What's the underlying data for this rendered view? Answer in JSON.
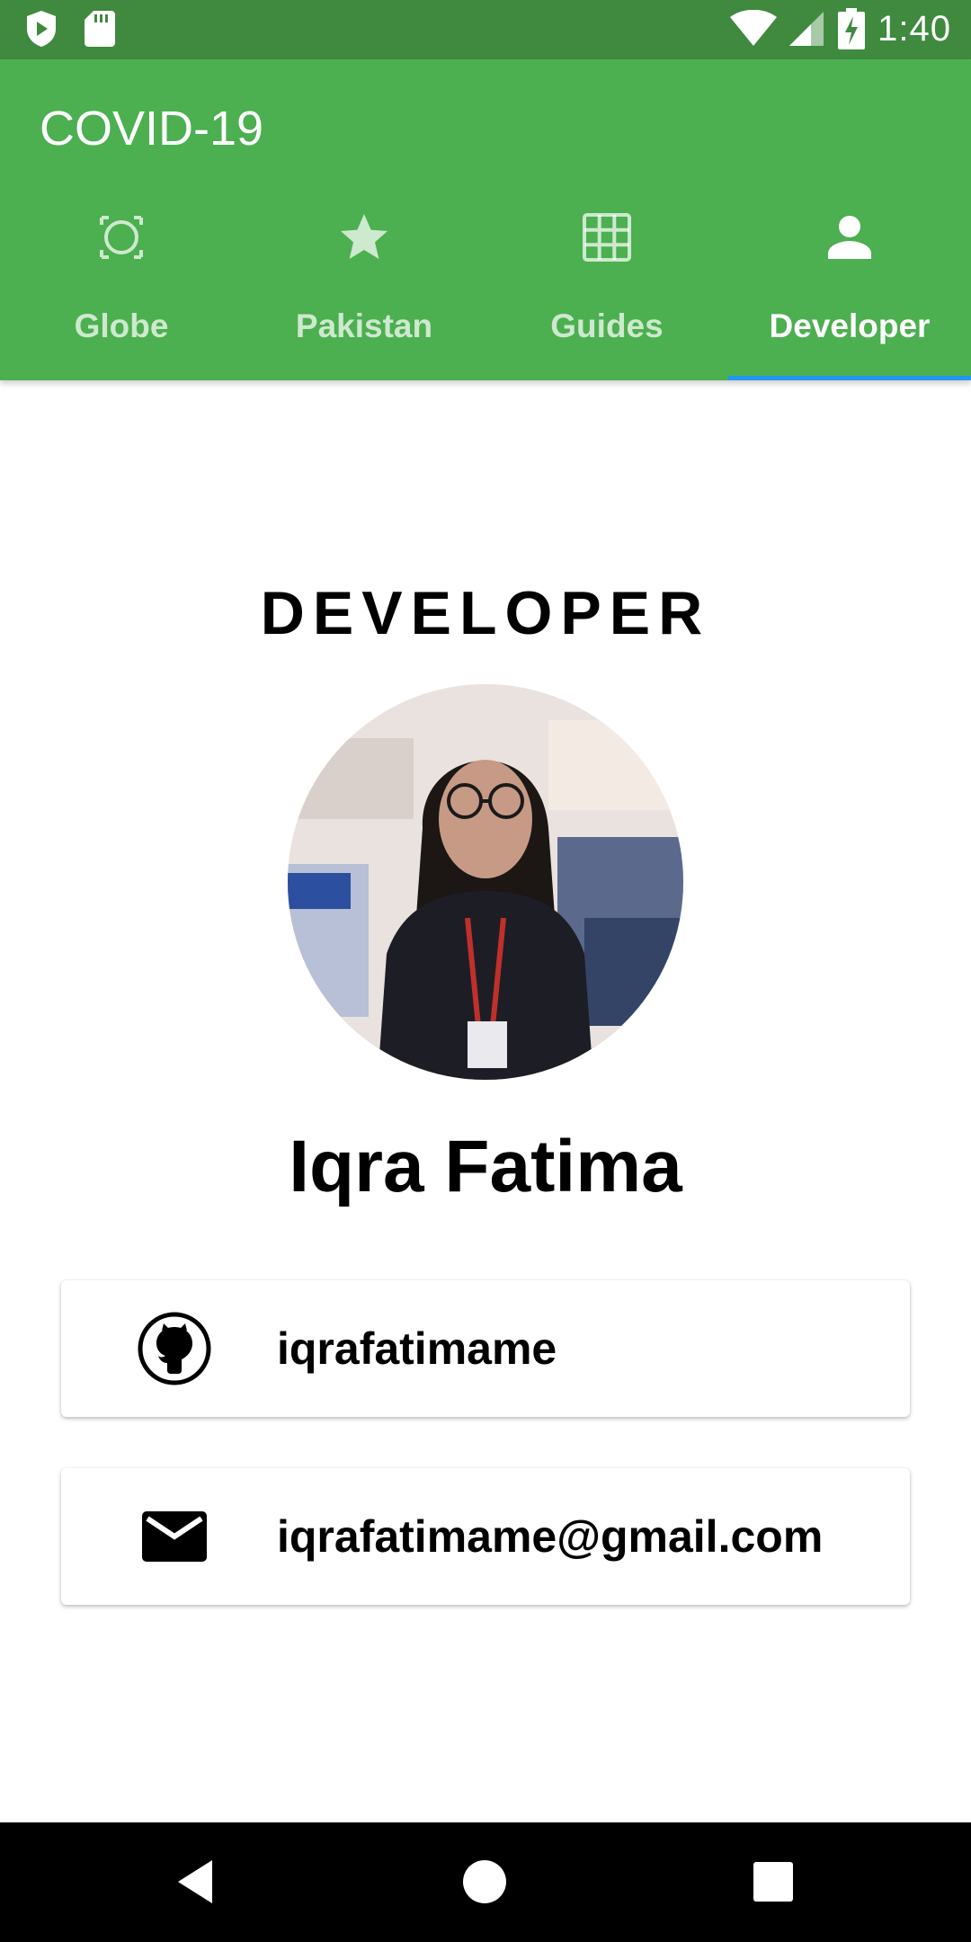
{
  "status_bar": {
    "time": "1:40",
    "icons": [
      "shield-icon",
      "sd-card-icon",
      "wifi-icon",
      "signal-icon",
      "battery-charging-icon"
    ]
  },
  "app_bar": {
    "title": "COVID-19",
    "background_color": "#4caf50"
  },
  "tabs": [
    {
      "label": "Globe",
      "icon": "globe-icon",
      "active": false
    },
    {
      "label": "Pakistan",
      "icon": "star-icon",
      "active": false
    },
    {
      "label": "Guides",
      "icon": "grid-icon",
      "active": false
    },
    {
      "label": "Developer",
      "icon": "person-icon",
      "active": true
    }
  ],
  "tab_indicator_color": "#2196f3",
  "developer": {
    "section_title": "DEVELOPER",
    "name": "Iqra Fatima",
    "github": {
      "icon": "github-icon",
      "username": "iqrafatimame"
    },
    "email": {
      "icon": "email-icon",
      "address": "iqrafatimame@gmail.com"
    }
  },
  "nav_bar": {
    "buttons": [
      "back-icon",
      "home-icon",
      "recents-icon"
    ]
  }
}
